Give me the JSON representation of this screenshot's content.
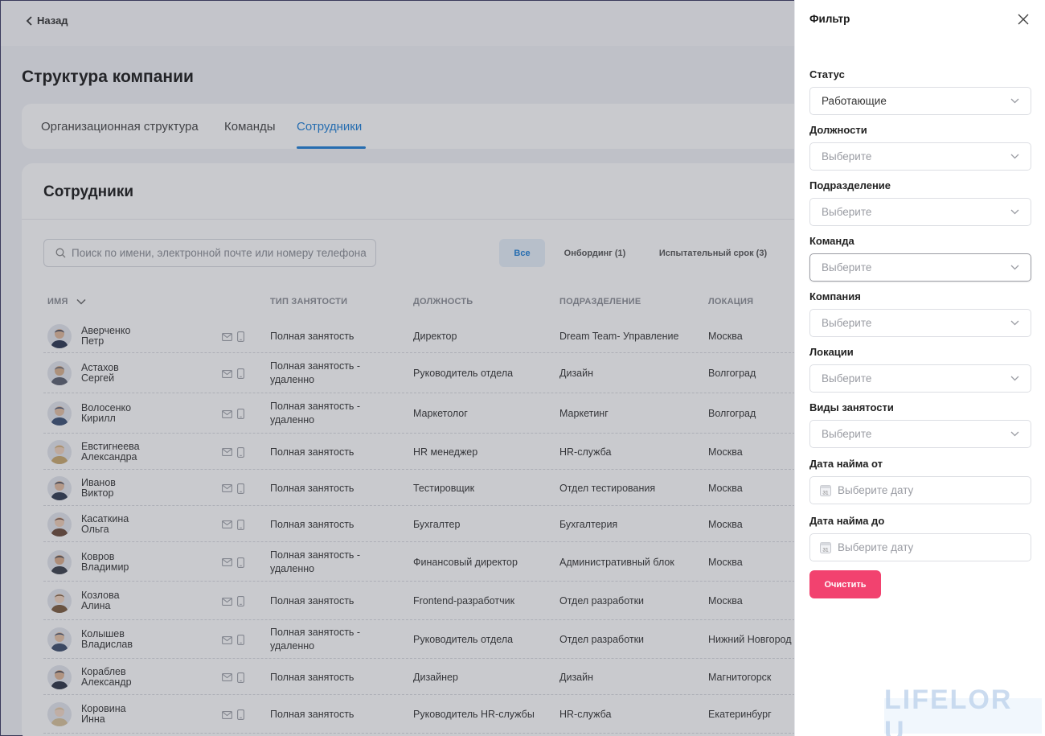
{
  "topbar": {
    "back_label": "Назад"
  },
  "page": {
    "title": "Структура компании"
  },
  "tabs": [
    {
      "label": "Организационная структура",
      "active": false
    },
    {
      "label": "Команды",
      "active": false
    },
    {
      "label": "Сотрудники",
      "active": true
    }
  ],
  "employees_section": {
    "title": "Сотрудники",
    "search_placeholder": "Поиск по имени, электронной почте или номеру телефона",
    "chips": [
      {
        "label": "Все",
        "active": true
      },
      {
        "label": "Онбординг (1)",
        "active": false
      },
      {
        "label": "Испытательный срок (3)",
        "active": false
      }
    ],
    "columns": {
      "name": "Имя",
      "employment": "Тип занятости",
      "position": "Должность",
      "department": "Подразделение",
      "location": "Локация"
    },
    "rows": [
      {
        "last": "Аверченко",
        "first": "Петр",
        "employment": "Полная занятость",
        "position": "Директор",
        "department": "Dream Team- Управление",
        "location": "Москва"
      },
      {
        "last": "Астахов",
        "first": "Сергей",
        "employment": "Полная занятость - удаленно",
        "position": "Руководитель отдела",
        "department": "Дизайн",
        "location": "Волгоград"
      },
      {
        "last": "Волосенко",
        "first": "Кирилл",
        "employment": "Полная занятость - удаленно",
        "position": "Маркетолог",
        "department": "Маркетинг",
        "location": "Волгоград"
      },
      {
        "last": "Евстигнеева",
        "first": "Александра",
        "employment": "Полная занятость",
        "position": "HR менеджер",
        "department": "HR-служба",
        "location": "Москва"
      },
      {
        "last": "Иванов",
        "first": "Виктор",
        "employment": "Полная занятость",
        "position": "Тестировщик",
        "department": "Отдел тестирования",
        "location": "Москва"
      },
      {
        "last": "Касаткина",
        "first": "Ольга",
        "employment": "Полная занятость",
        "position": "Бухгалтер",
        "department": "Бухгалтерия",
        "location": "Москва"
      },
      {
        "last": "Ковров",
        "first": "Владимир",
        "employment": "Полная занятость - удаленно",
        "position": "Финансовый директор",
        "department": "Административный блок",
        "location": "Москва"
      },
      {
        "last": "Козлова",
        "first": "Алина",
        "employment": "Полная занятость",
        "position": "Frontend-разработчик",
        "department": "Отдел разработки",
        "location": "Москва"
      },
      {
        "last": "Колышев",
        "first": "Владислав",
        "employment": "Полная занятость - удаленно",
        "position": "Руководитель отдела",
        "department": "Отдел разработки",
        "location": "Нижний Новгород"
      },
      {
        "last": "Кораблев",
        "first": "Александр",
        "employment": "Полная занятость",
        "position": "Дизайнер",
        "department": "Дизайн",
        "location": "Магнитогорск"
      },
      {
        "last": "Коровина",
        "first": "Инна",
        "employment": "Полная занятость",
        "position": "Руководитель HR-службы",
        "department": "HR-служба",
        "location": "Екатеринбург"
      }
    ]
  },
  "filter": {
    "title": "Фильтр",
    "fields": [
      {
        "label": "Статус",
        "value": "Работающие",
        "placeholder": ""
      },
      {
        "label": "Должности",
        "value": "",
        "placeholder": "Выберите"
      },
      {
        "label": "Подразделение",
        "value": "",
        "placeholder": "Выберите"
      },
      {
        "label": "Команда",
        "value": "",
        "placeholder": "Выберите"
      },
      {
        "label": "Компания",
        "value": "",
        "placeholder": "Выберите"
      },
      {
        "label": "Локации",
        "value": "",
        "placeholder": "Выберите"
      },
      {
        "label": "Виды занятости",
        "value": "",
        "placeholder": "Выберите"
      }
    ],
    "date_from": {
      "label": "Дата найма от",
      "placeholder": "Выберите дату"
    },
    "date_to": {
      "label": "Дата найма до",
      "placeholder": "Выберите дату"
    },
    "calendar_day": "31",
    "clear_label": "Очистить"
  },
  "watermark": "LIFELOR U",
  "colors": {
    "accent": "#1e7fd6",
    "danger": "#f2426f",
    "overlay": "#3c404e"
  }
}
